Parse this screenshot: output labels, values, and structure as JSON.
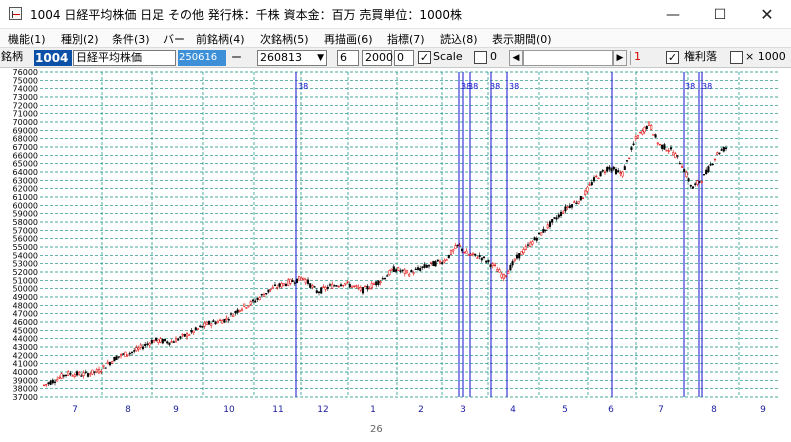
{
  "window": {
    "title": "1004 日経平均株価 日足 その他 発行株：千株 資本金：百万 売買単位：1000株",
    "minimize": "—",
    "maximize": "☐",
    "close": "✕"
  },
  "menu": [
    {
      "label": "機能(1)",
      "name": "menu-function"
    },
    {
      "label": "種別(2)",
      "name": "menu-type"
    },
    {
      "label": "条件(3)",
      "name": "menu-condition"
    },
    {
      "label": "バー",
      "name": "menu-bar"
    },
    {
      "label": "前銘柄(4)",
      "name": "menu-prev-stock"
    },
    {
      "label": "次銘柄(5)",
      "name": "menu-next-stock"
    },
    {
      "label": "再描画(6)",
      "name": "menu-redraw"
    },
    {
      "label": "指標(7)",
      "name": "menu-indicator"
    },
    {
      "label": "読込(8)",
      "name": "menu-load"
    },
    {
      "label": "表示期間(0)",
      "name": "menu-display-period"
    }
  ],
  "toolbar": {
    "stock_label": "銘柄",
    "code": "1004",
    "stock_name": "日経平均株価",
    "start_date": "250616",
    "dash": "ー",
    "end_date": "260813",
    "dropdown_arrow": "▼",
    "field_a": "6",
    "field_b": "2000",
    "field_c": "0",
    "scale_checked": "✓",
    "scale_label": "Scale",
    "field_d": "0",
    "scroll_left": "◀",
    "scroll_right": "▶",
    "marker_value": "1",
    "rights_checked": "✓",
    "rights_label": "権利落",
    "x1000_label": "× 1000"
  },
  "chart_data": {
    "type": "candlestick",
    "y_axis": {
      "min": 37000,
      "max": 76000,
      "step": 1000,
      "tick_labels": [
        "37000",
        "38000",
        "39000",
        "40000",
        "41000",
        "42000",
        "43000",
        "44000",
        "45000",
        "46000",
        "47000",
        "48000",
        "49000",
        "50000",
        "51000",
        "52000",
        "53000",
        "54000",
        "55000",
        "56000",
        "57000",
        "58000",
        "59000",
        "60000",
        "61000",
        "62000",
        "63000",
        "64000",
        "65000",
        "66000",
        "67000",
        "68000",
        "69000",
        "70000",
        "71000",
        "72000",
        "73000",
        "74000",
        "75000",
        "76000"
      ]
    },
    "x_axis": {
      "month_labels": [
        "7",
        "8",
        "9",
        "10",
        "11",
        "12",
        "1",
        "2",
        "3",
        "4",
        "5",
        "6",
        "7",
        "8",
        "9"
      ],
      "year_label": "26"
    },
    "event_marker_label": "38",
    "grid": true,
    "colors": {
      "up": "#e00000",
      "down": "#000000",
      "grid": "#0a8a7a",
      "vline": "#1010cc",
      "axis_text": "#000000",
      "month_text": "#1a1aa0"
    },
    "trend_points": [
      [
        0,
        38400
      ],
      [
        15,
        39200
      ],
      [
        25,
        39800
      ],
      [
        45,
        39700
      ],
      [
        60,
        40100
      ],
      [
        80,
        41800
      ],
      [
        100,
        42500
      ],
      [
        120,
        43800
      ],
      [
        140,
        43600
      ],
      [
        160,
        44600
      ],
      [
        180,
        45800
      ],
      [
        200,
        46300
      ],
      [
        215,
        47600
      ],
      [
        230,
        48400
      ],
      [
        250,
        50000
      ],
      [
        270,
        50800
      ],
      [
        285,
        51300
      ],
      [
        300,
        49600
      ],
      [
        315,
        50300
      ],
      [
        330,
        50700
      ],
      [
        350,
        49800
      ],
      [
        370,
        51000
      ],
      [
        385,
        52400
      ],
      [
        400,
        51800
      ],
      [
        420,
        52700
      ],
      [
        440,
        53400
      ],
      [
        455,
        55200
      ],
      [
        465,
        54100
      ],
      [
        480,
        53800
      ],
      [
        495,
        52600
      ],
      [
        505,
        51400
      ],
      [
        520,
        53800
      ],
      [
        540,
        56000
      ],
      [
        560,
        58200
      ],
      [
        575,
        59800
      ],
      [
        590,
        60800
      ],
      [
        605,
        63200
      ],
      [
        620,
        64600
      ],
      [
        635,
        63700
      ],
      [
        650,
        68000
      ],
      [
        665,
        69800
      ],
      [
        675,
        67300
      ],
      [
        690,
        66500
      ],
      [
        700,
        65000
      ],
      [
        712,
        62000
      ],
      [
        725,
        63500
      ],
      [
        740,
        66300
      ],
      [
        750,
        67000
      ]
    ]
  }
}
